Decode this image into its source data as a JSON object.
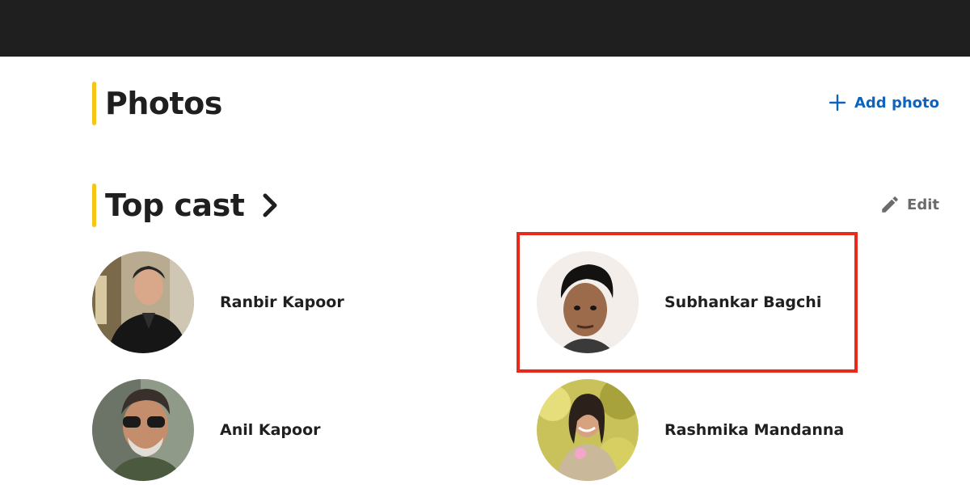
{
  "photos_section": {
    "title": "Photos",
    "add_label": "Add photo"
  },
  "cast_section": {
    "title": "Top cast",
    "edit_label": "Edit",
    "members": [
      {
        "name": "Ranbir Kapoor"
      },
      {
        "name": "Subhankar Bagchi"
      },
      {
        "name": "Anil Kapoor"
      },
      {
        "name": "Rashmika Mandanna"
      }
    ]
  },
  "colors": {
    "top_bar": "#1f1f1f",
    "accent": "#f5c518",
    "link": "#0e63be",
    "edit": "#6b6b6b",
    "highlight": "#e8291c"
  }
}
